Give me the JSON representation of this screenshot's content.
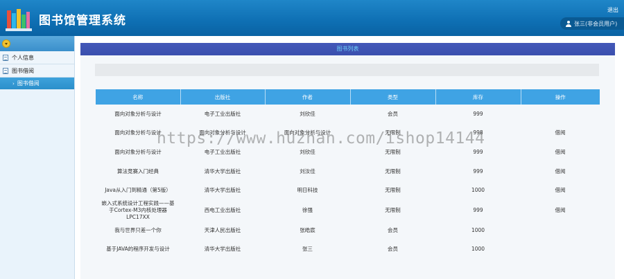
{
  "header": {
    "title": "图书馆管理系统",
    "logout": "退出",
    "user": "张三(非会员用户)"
  },
  "sidebar": {
    "items": [
      {
        "label": "个人信息",
        "icon": "doc-icon"
      },
      {
        "label": "图书借阅",
        "icon": "doc-icon"
      }
    ],
    "active_sub": "图书借阅"
  },
  "main": {
    "panel_title": "图书列表",
    "columns": [
      "名称",
      "出版社",
      "作者",
      "类型",
      "库存",
      "操作"
    ],
    "rows": [
      [
        "面向对象分析与设计",
        "电子工业出版社",
        "刘欣佳",
        "会员",
        "999",
        ""
      ],
      [
        "面向对象分析与设计",
        "面向对象分析与设计",
        "面向对象分析与设计",
        "无限制",
        "998",
        "借阅"
      ],
      [
        "面向对象分析与设计",
        "电子工业出版社",
        "刘欣佳",
        "无限制",
        "999",
        "借阅"
      ],
      [
        "算法竞赛入门经典",
        "清华大学出版社",
        "刘汝佳",
        "无限制",
        "999",
        "借阅"
      ],
      [
        "Java从入门到精通（第5版）",
        "清华大学出版社",
        "明日科技",
        "无限制",
        "1000",
        "借阅"
      ],
      [
        "嵌入式系统设计工程实践——基于Cortex-M3内核处理器LPC17XX",
        "西电工业出版社",
        "徐强",
        "无限制",
        "999",
        "借阅"
      ],
      [
        "我与世界只差一个你",
        "天津人民出版社",
        "张皓宸",
        "会员",
        "1000",
        ""
      ],
      [
        "基于JAVA的程序开发与设计",
        "清华大学出版社",
        "张三",
        "会员",
        "1000",
        ""
      ]
    ]
  },
  "watermark": "https://www.huzhan.com/ishop14144",
  "colors": {
    "header": "#0e6fb3",
    "panel": "#3f51b5",
    "table_head": "#3fa3e4",
    "side_active": "#2b8fcb"
  }
}
